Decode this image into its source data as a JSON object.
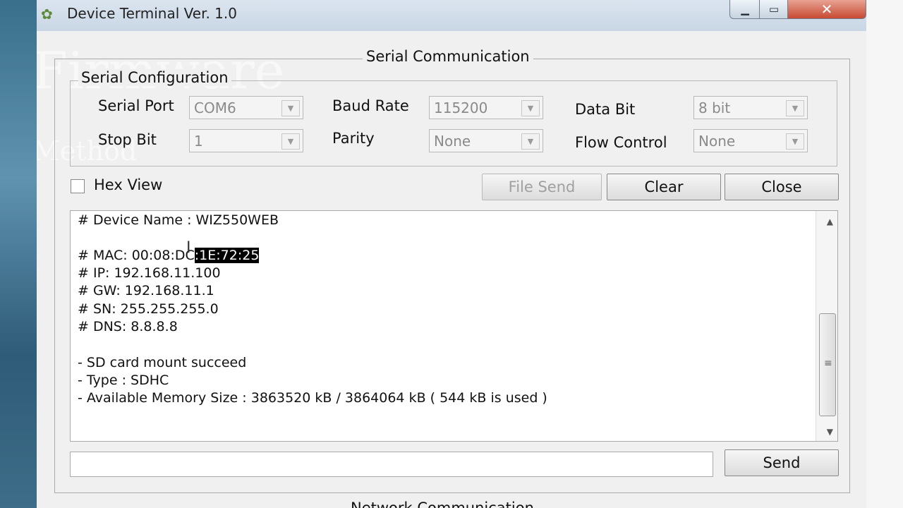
{
  "window": {
    "title": "Device Terminal Ver. 1.0",
    "icon": "gear-icon"
  },
  "watermark": {
    "line1": "Firmware",
    "line2": "Method"
  },
  "serial_communication": {
    "legend": "Serial Communication",
    "config": {
      "legend": "Serial Configuration",
      "serial_port": {
        "label": "Serial Port",
        "value": "COM6"
      },
      "baud_rate": {
        "label": "Baud Rate",
        "value": "115200"
      },
      "data_bit": {
        "label": "Data Bit",
        "value": "8 bit"
      },
      "stop_bit": {
        "label": "Stop Bit",
        "value": "1"
      },
      "parity": {
        "label": "Parity",
        "value": "None"
      },
      "flow_control": {
        "label": "Flow Control",
        "value": "None"
      }
    },
    "hex_view_label": "Hex View",
    "buttons": {
      "file_send": "File Send",
      "clear": "Clear",
      "close": "Close",
      "send": "Send"
    },
    "log": {
      "device_name": "# Device Name : WIZ550WEB",
      "mac_prefix": "# MAC: 00:08:DC",
      "mac_selected": ":1E:72:25",
      "ip": "# IP: 192.168.11.100",
      "gw": "# GW: 192.168.11.1",
      "sn": "# SN: 255.255.255.0",
      "dns": "# DNS: 8.8.8.8",
      "sd_mount": "- SD card mount succeed",
      "type": "- Type : SDHC",
      "memory": "- Available Memory Size : 3863520 kB / 3864064 kB ( 544 kB is used )"
    },
    "send_input_value": ""
  },
  "next_section_title": "Network Communication"
}
